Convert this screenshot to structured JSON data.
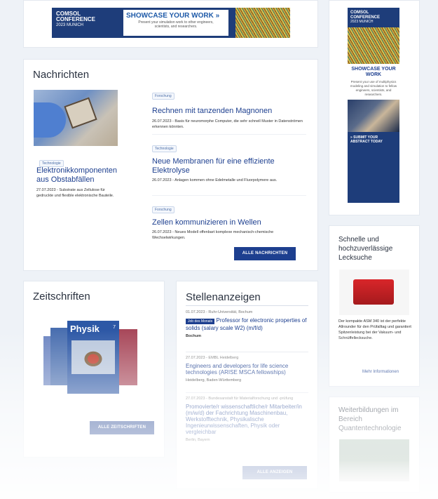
{
  "banner_top": {
    "brand_line1": "COMSOL",
    "brand_line2": "CONFERENCE",
    "brand_line3": "2023 MUNICH",
    "headline": "SHOWCASE YOUR WORK »",
    "subline": "Present your simulation work to other engineers, scientists, and researchers."
  },
  "news": {
    "heading": "Nachrichten",
    "feature": {
      "tag": "Technologie",
      "title": "Elektronikkomponenten aus Obstabfällen",
      "meta": "27.07.2023 - Substrate aus Zellulose für gedruckte und flexible elektronische Bauteile."
    },
    "items": [
      {
        "tag": "Forschung",
        "title": "Rechnen mit tanzenden Magnonen",
        "meta": "26.07.2023 - Basis für neuromorphe Computer, die sehr schnell Muster in Datenströmen erkennen könnten."
      },
      {
        "tag": "Technologie",
        "title": "Neue Membranen für eine effiziente Elektrolyse",
        "meta": "26.07.2023 - Anlagen kommen ohne Edelmetalle und Fluorpolymere aus."
      },
      {
        "tag": "Forschung",
        "title": "Zellen kommunizieren in Wellen",
        "meta": "26.07.2023 - Neues Modell offenbart komplexe mechanisch-chemische Wechselwirkungen."
      }
    ],
    "all_button": "ALLE NACHRICHTEN"
  },
  "journals": {
    "heading": "Zeitschriften",
    "cover_title": "Physik",
    "cover_issue": "7",
    "all_button": "ALLE ZEITSCHRIFTEN"
  },
  "jobs": {
    "heading": "Stellenanzeigen",
    "items": [
      {
        "meta": "01.07.2023 - Ruhr-Universität, Bochum",
        "badge": "Job des Monats",
        "title": "Professor for electronic properties of solids (salary scale W2) (m/f/d)",
        "location": "Bochum"
      },
      {
        "meta": "27.07.2023 - EMBL Heidelberg",
        "title": "Engineers and developers for life science technologies (ARISE MSCA fellowships)",
        "location": "Heidelberg, Baden-Württemberg"
      },
      {
        "meta": "27.07.2023 - Bundesanstalt für Materialforschung und -prüfung",
        "title": "Promovierte/r wissenschaftliche/r Mitarbeiter/in (m/w/d) der Fachrichtung Maschinenbau, Werkstofftechnik, Physikalische Ingenieurwissenschaften, Physik oder vergleichbar",
        "location": "Berlin, Bayern"
      }
    ],
    "all_button": "ALLE ANZEIGEN"
  },
  "side_banner": {
    "brand_line1": "COMSOL",
    "brand_line2": "CONFERENCE",
    "brand_line3": "2023 MUNICH",
    "headline": "SHOWCASE YOUR WORK",
    "body": "Present your use of multiphysics modeling and simulation to fellow engineers, scientists, and researchers.",
    "cta": "» SUBMIT YOUR ABSTRACT TODAY"
  },
  "side_ad": {
    "heading": "Schnelle und hochzuverlässige Lecksuche",
    "body": "Der kompakte ASM 340 ist der perfekte Allrounder für den Prüfalltag und garantiert Spitzenleistung bei der Vakuum- und Schnüffellecksuche.",
    "link": "Mehr Informationen"
  },
  "side_training": {
    "heading": "Weiterbildungen im Bereich Quantentechnologie"
  },
  "colors": {
    "accent": "#1d3f8f",
    "banner_bg": "#1e3d7a",
    "background": "#eef2f7"
  }
}
